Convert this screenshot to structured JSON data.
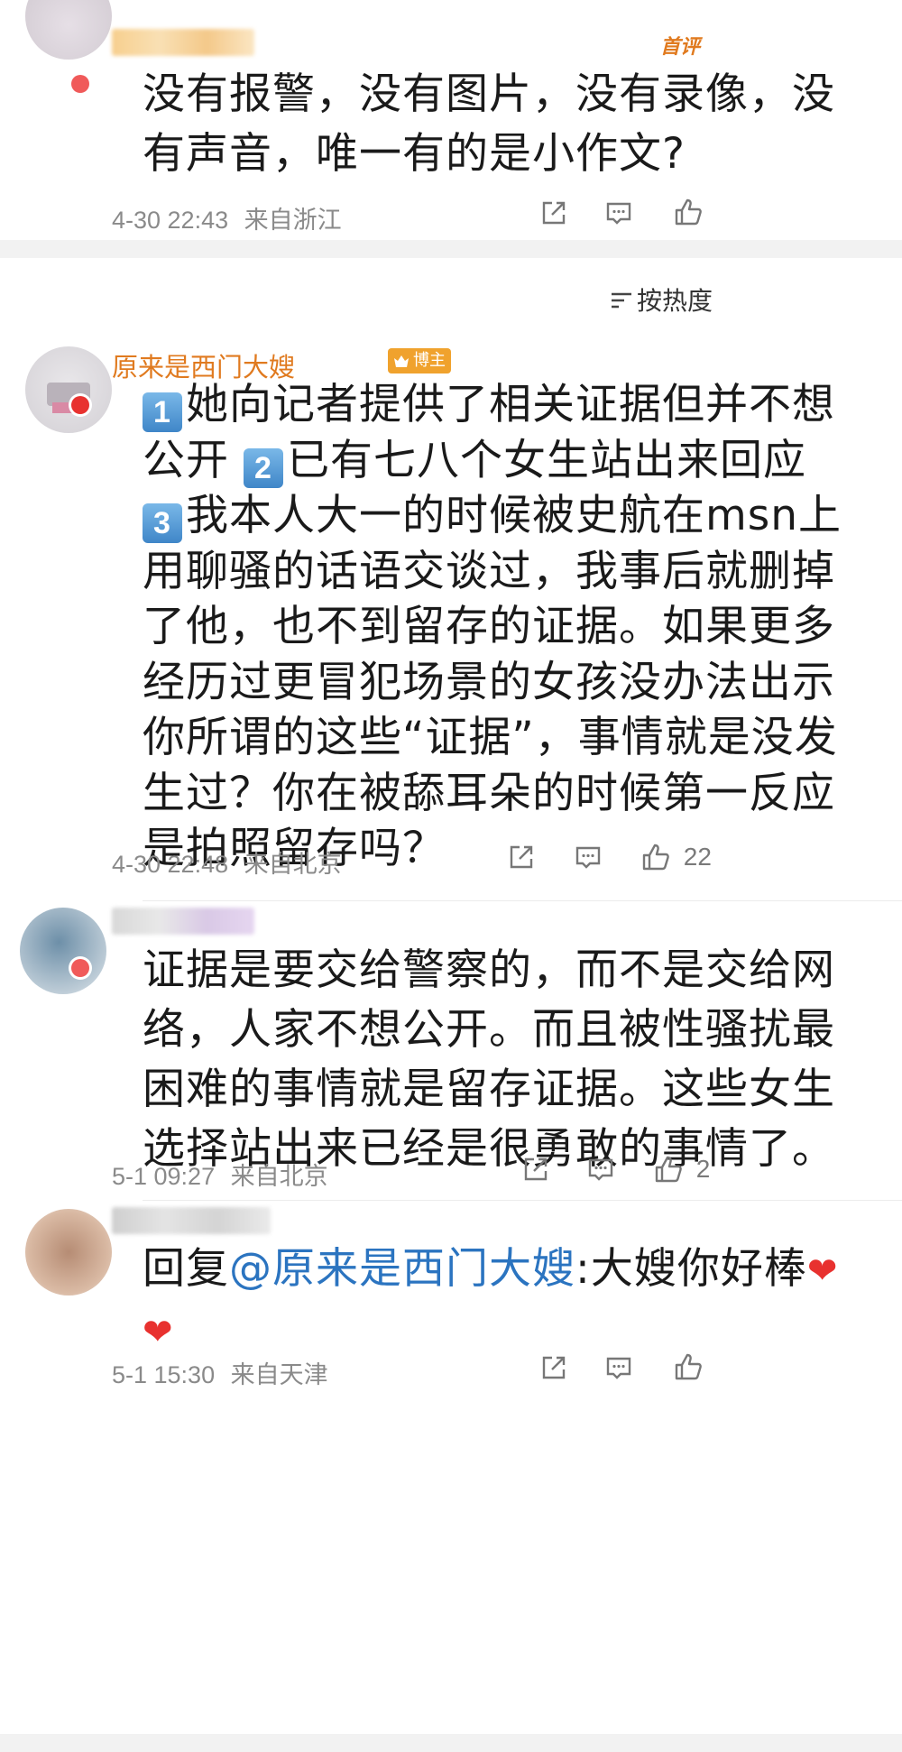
{
  "comment_top": {
    "badge": "首评",
    "text": "没有报警，没有图片，没有录像，没有声音，唯一有的是小作文?",
    "time": "4-30 22:43",
    "location": "来自浙江"
  },
  "sort": {
    "icon": "sort-icon",
    "label": "按热度"
  },
  "comments": [
    {
      "username": "原来是西门大嫂",
      "author_badge": "博主",
      "items": [
        {
          "num": "1",
          "text": "她向记者提供了相关证据但并不想公开 "
        },
        {
          "num": "2",
          "text": "已有七八个女生站出来回应"
        },
        {
          "num": "3",
          "text": "我本人大一的时候被史航在msn上用聊骚的话语交谈过，我事后就删掉了他，也不到留存的证据。如果更多经历过更冒犯场景的女孩没办法出示你所谓的这些“证据”，事情就是没发生过？你在被舔耳朵的时候第一反应是拍照留存吗？"
        }
      ],
      "time": "4-30 22:48",
      "location": "来自北京",
      "likes": "22"
    },
    {
      "text": "证据是要交给警察的，而不是交给网络，人家不想公开。而且被性骚扰最困难的事情就是留存证据。这些女生选择站出来已经是很勇敢的事情了。",
      "time": "5-1 09:27",
      "location": "来自北京",
      "likes": "2"
    },
    {
      "reply_prefix": "回复",
      "mention": "@原来是西门大嫂",
      "text": ":大嫂你好棒",
      "time": "5-1 15:30",
      "location": "来自天津"
    }
  ],
  "colors": {
    "accent_orange": "#e07a1f",
    "mention_blue": "#2b74c0",
    "heart_red": "#e8312f"
  }
}
